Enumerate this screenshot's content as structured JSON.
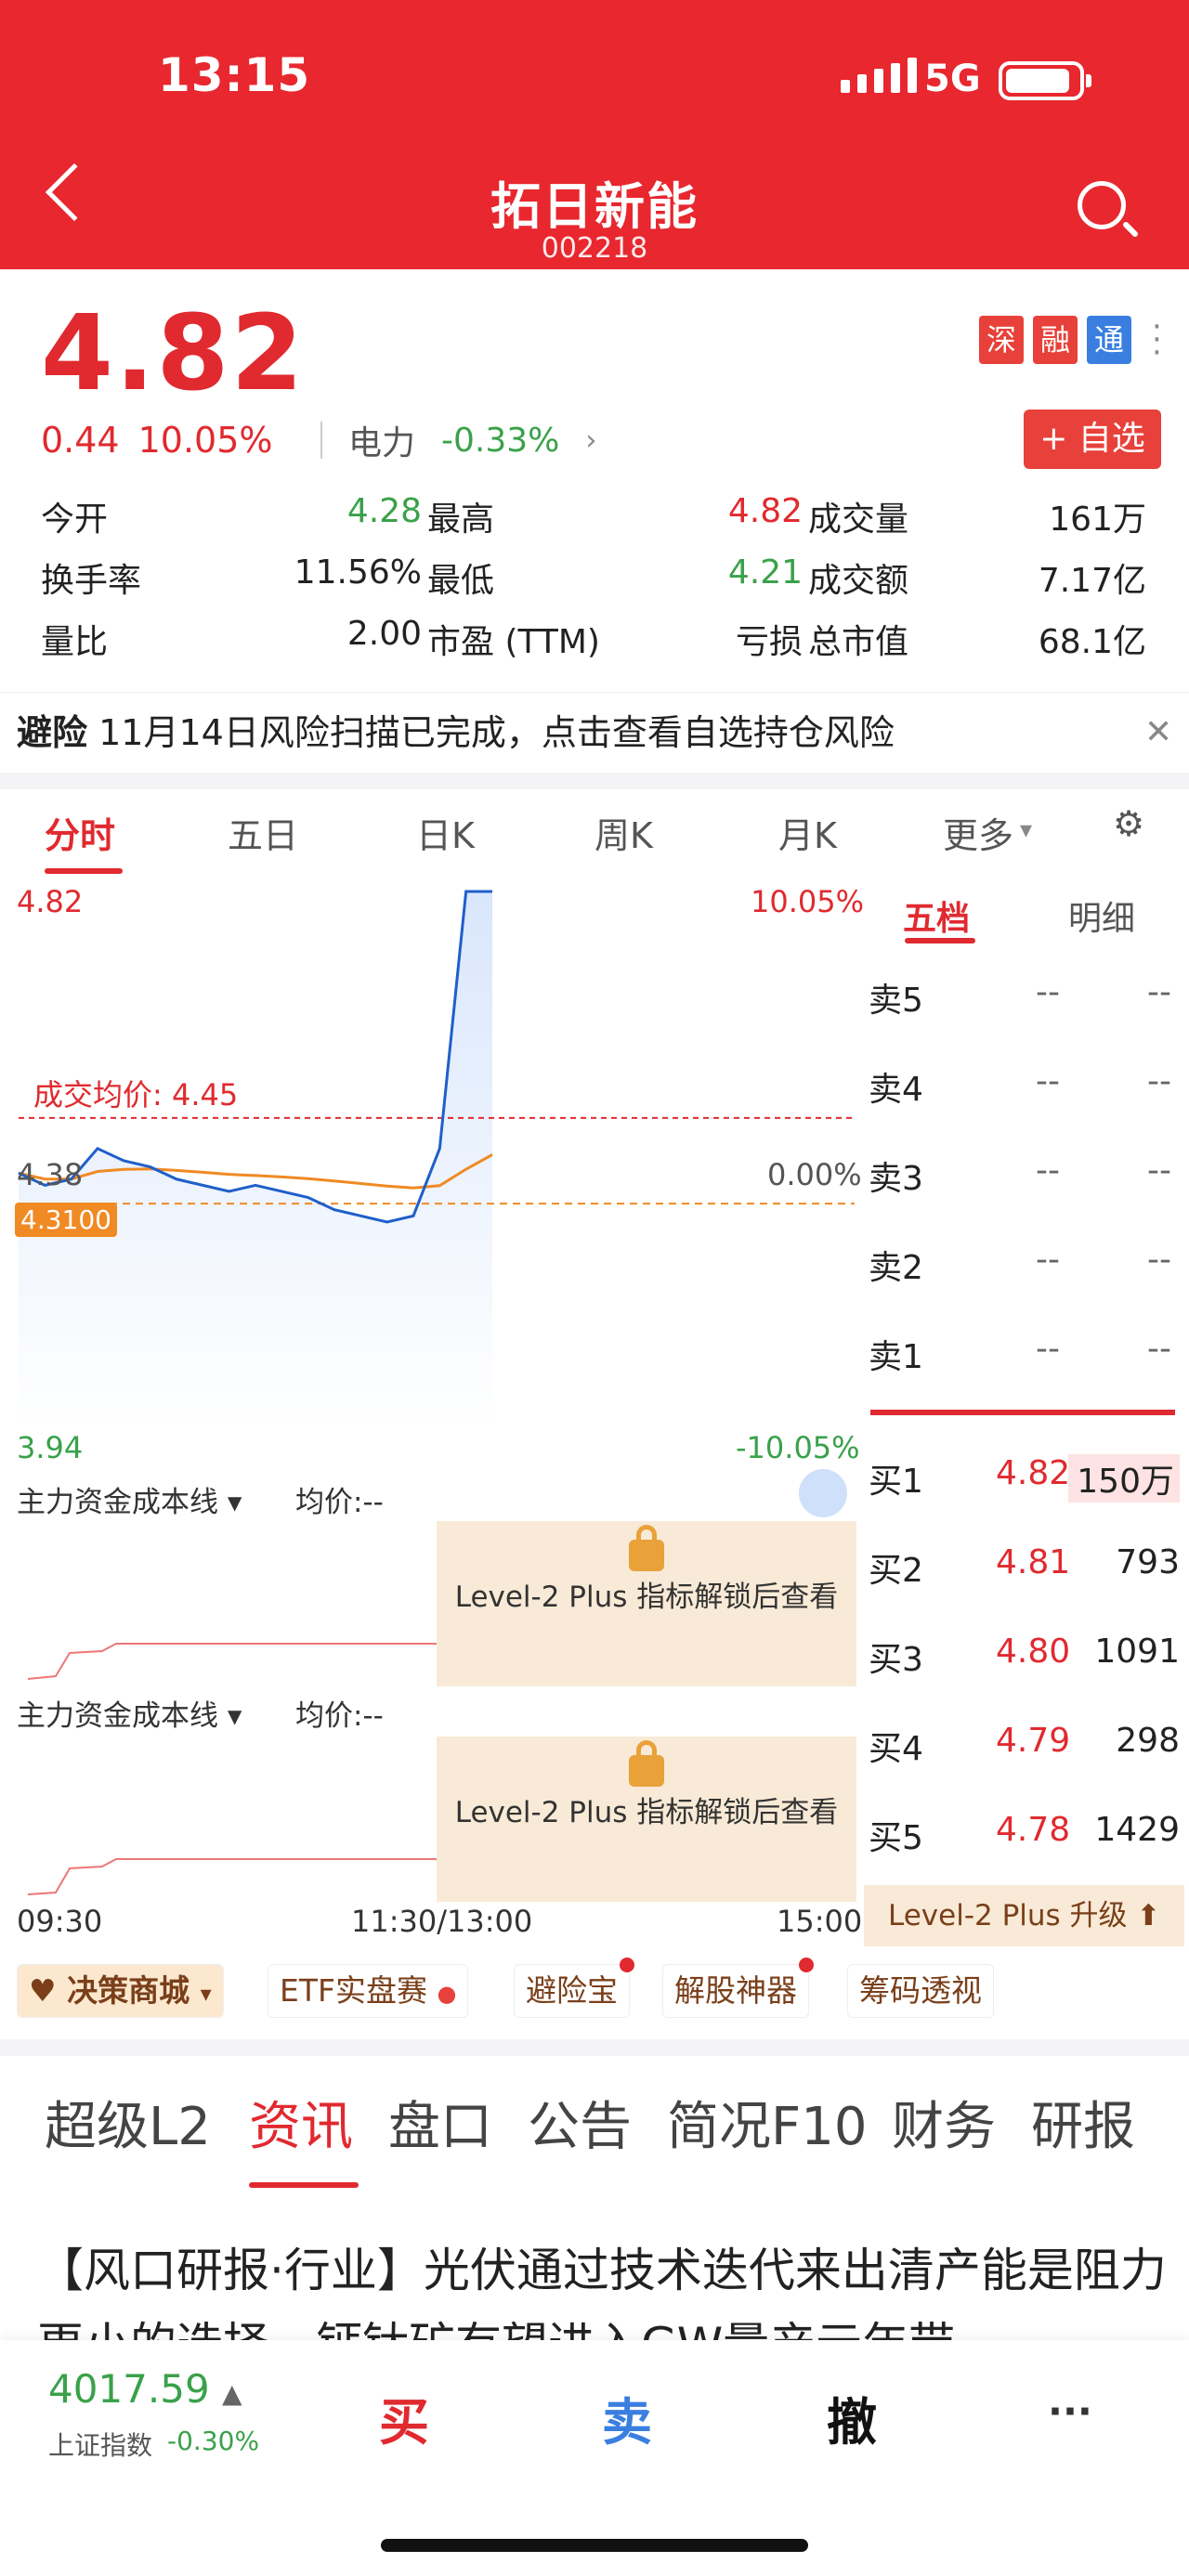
{
  "status_bar": {
    "time": "13:15",
    "network": "5G"
  },
  "header": {
    "title": "拓日新能",
    "code": "002218"
  },
  "quote": {
    "price": "4.82",
    "change": "0.44",
    "change_pct": "10.05%",
    "sector": "电力",
    "sector_pct": "-0.33%",
    "badges": [
      "深",
      "融",
      "通"
    ],
    "add_watch": "+ 自选"
  },
  "stats": [
    [
      {
        "label": "今开",
        "value": "4.28"
      },
      {
        "label": "最高",
        "value": "4.82"
      },
      {
        "label": "成交量",
        "value": "161万"
      }
    ],
    [
      {
        "label": "换手率",
        "value": "11.56%"
      },
      {
        "label": "最低",
        "value": "4.21"
      },
      {
        "label": "成交额",
        "value": "7.17亿"
      }
    ],
    [
      {
        "label": "量比",
        "value": "2.00"
      },
      {
        "label": "市盈 (TTM)",
        "value": "亏损"
      },
      {
        "label": "总市值",
        "value": "68.1亿"
      }
    ]
  ],
  "notice": {
    "tag": "避险",
    "text": "11月14日风险扫描已完成，点击查看自选持仓风险"
  },
  "chart_tabs": [
    "分时",
    "五日",
    "日K",
    "周K",
    "月K",
    "更多"
  ],
  "chart": {
    "y_max": "4.82",
    "y_max_pct": "10.05%",
    "y_mid": "4.38",
    "y_mid_pct": "0.00%",
    "y_min": "3.94",
    "y_min_pct": "-10.05%",
    "avg_label": "成交均价:",
    "avg_value": "4.45",
    "prev_close_tag": "4.3100",
    "x_labels": [
      "09:30",
      "11:30/13:00",
      "15:00"
    ]
  },
  "chart_data": {
    "type": "line",
    "title": "",
    "ylim": [
      3.94,
      4.82
    ],
    "x": [
      "09:30",
      "11:30/13:00",
      "15:00"
    ],
    "series": [
      {
        "values": [
          4.36,
          4.34,
          4.35,
          4.4,
          4.38,
          4.37,
          4.35,
          4.34,
          4.33,
          4.34,
          4.33,
          4.32,
          4.3,
          4.29,
          4.28,
          4.29,
          4.4,
          4.82,
          4.82
        ]
      }
    ],
    "reference_lines": [
      {
        "label": "成交均价",
        "value": 4.45
      },
      {
        "label": "昨收",
        "value": 4.31
      }
    ]
  },
  "indicator_panels": [
    {
      "name": "主力资金成本线",
      "avg": "均价:--",
      "lock_text": "Level-2 Plus 指标解锁后查看"
    },
    {
      "name": "主力资金成本线",
      "avg": "均价:--",
      "lock_text": "Level-2 Plus 指标解锁后查看"
    }
  ],
  "order_book": {
    "tabs": [
      "五档",
      "明细"
    ],
    "sell": [
      {
        "label": "卖5",
        "price": "--",
        "vol": "--"
      },
      {
        "label": "卖4",
        "price": "--",
        "vol": "--"
      },
      {
        "label": "卖3",
        "price": "--",
        "vol": "--"
      },
      {
        "label": "卖2",
        "price": "--",
        "vol": "--"
      },
      {
        "label": "卖1",
        "price": "--",
        "vol": "--"
      }
    ],
    "buy": [
      {
        "label": "买1",
        "price": "4.82",
        "vol": "150万"
      },
      {
        "label": "买2",
        "price": "4.81",
        "vol": "793"
      },
      {
        "label": "买3",
        "price": "4.80",
        "vol": "1091"
      },
      {
        "label": "买4",
        "price": "4.79",
        "vol": "298"
      },
      {
        "label": "买5",
        "price": "4.78",
        "vol": "1429"
      }
    ],
    "upgrade": "Level-2 Plus 升级"
  },
  "tools": [
    "决策商城",
    "ETF实盘赛",
    "避险宝",
    "解股神器",
    "筹码透视"
  ],
  "content_tabs": [
    "超级L2",
    "资讯",
    "盘口",
    "公告",
    "简况F10",
    "财务",
    "研报"
  ],
  "news": "【风口研报·行业】光伏通过技术迭代来出清产能是阻力更小的选择，钙钛矿有望进入GW量产元年带",
  "footer": {
    "index_value": "4017.59",
    "index_name": "上证指数",
    "index_pct": "-0.30%",
    "buy": "买",
    "sell": "卖",
    "cancel": "撤",
    "more": "···"
  },
  "colors": {
    "brand": "#e8272f",
    "up": "#e02a2f",
    "down": "#3aa14a",
    "line": "#1f5fc9",
    "avg": "#f08a24"
  }
}
